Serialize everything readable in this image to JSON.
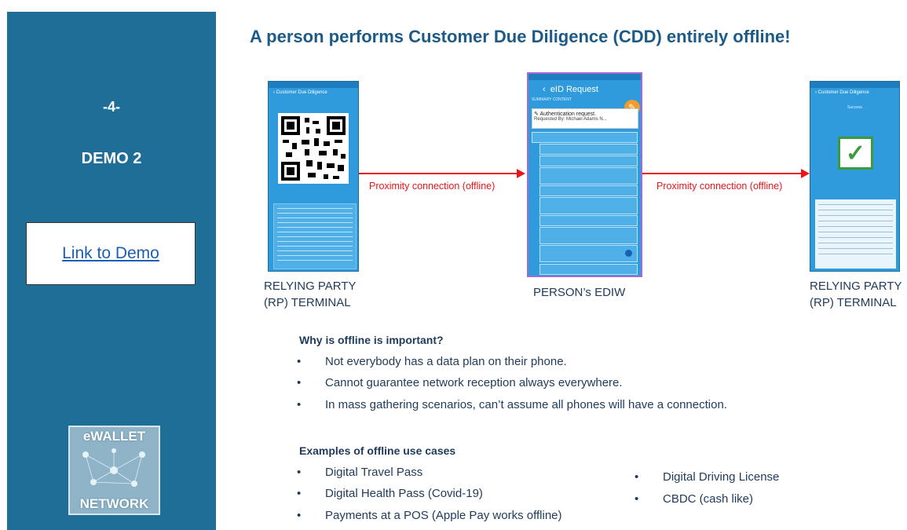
{
  "sidebar": {
    "slide_number": "-4-",
    "demo_title": "DEMO 2",
    "link_label": "Link to Demo",
    "logo_top": "eWALLET",
    "logo_bottom": "NETWORK",
    "bg_color": "#1e6e98"
  },
  "title": "A person performs Customer Due Diligence (CDD) entirely offline!",
  "diagram": {
    "left_caption_line1": "RELYING PARTY",
    "left_caption_line2": "(RP) TERMINAL",
    "middle_caption": "PERSON’s EDIW",
    "right_caption_line1": "RELYING PARTY",
    "right_caption_line2": "(RP) TERMINAL",
    "arrow1_label": "Proximity connection (offline)",
    "arrow2_label": "Proximity connection (offline)",
    "arrow_color": "#e8151b"
  },
  "phones": {
    "left_title": "Customer Due Diligence",
    "right_title": "Customer Due Diligence",
    "right_subtitle": "Success",
    "middle_title": "eID Request",
    "middle_tabs": "SUMMARY  CONTENT",
    "middle_auth_line1": "Authentication request.",
    "middle_auth_line2": "Requested By: Michael Adams N..."
  },
  "why": {
    "heading": "Why is offline is important?",
    "bullets": [
      "Not everybody has a data plan on their phone.",
      "Cannot guarantee network reception always everywhere.",
      "In mass gathering scenarios, can’t assume all phones will have a connection."
    ]
  },
  "examples": {
    "heading": "Examples of offline use cases",
    "left_bullets": [
      "Digital Travel Pass",
      "Digital Health Pass (Covid-19)",
      "Payments at a POS (Apple Pay works offline)"
    ],
    "right_bullets": [
      "Digital Driving License",
      "CBDC (cash like)"
    ]
  },
  "bullet_glyph": "•"
}
